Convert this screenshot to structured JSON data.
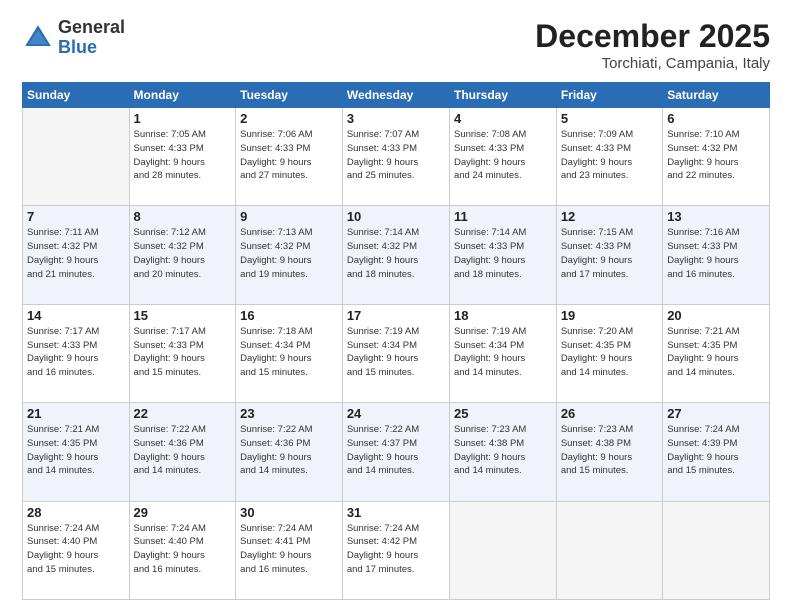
{
  "logo": {
    "general": "General",
    "blue": "Blue"
  },
  "header": {
    "month": "December 2025",
    "location": "Torchiati, Campania, Italy"
  },
  "days_of_week": [
    "Sunday",
    "Monday",
    "Tuesday",
    "Wednesday",
    "Thursday",
    "Friday",
    "Saturday"
  ],
  "weeks": [
    [
      {
        "num": "",
        "info": ""
      },
      {
        "num": "1",
        "info": "Sunrise: 7:05 AM\nSunset: 4:33 PM\nDaylight: 9 hours\nand 28 minutes."
      },
      {
        "num": "2",
        "info": "Sunrise: 7:06 AM\nSunset: 4:33 PM\nDaylight: 9 hours\nand 27 minutes."
      },
      {
        "num": "3",
        "info": "Sunrise: 7:07 AM\nSunset: 4:33 PM\nDaylight: 9 hours\nand 25 minutes."
      },
      {
        "num": "4",
        "info": "Sunrise: 7:08 AM\nSunset: 4:33 PM\nDaylight: 9 hours\nand 24 minutes."
      },
      {
        "num": "5",
        "info": "Sunrise: 7:09 AM\nSunset: 4:33 PM\nDaylight: 9 hours\nand 23 minutes."
      },
      {
        "num": "6",
        "info": "Sunrise: 7:10 AM\nSunset: 4:32 PM\nDaylight: 9 hours\nand 22 minutes."
      }
    ],
    [
      {
        "num": "7",
        "info": "Sunrise: 7:11 AM\nSunset: 4:32 PM\nDaylight: 9 hours\nand 21 minutes."
      },
      {
        "num": "8",
        "info": "Sunrise: 7:12 AM\nSunset: 4:32 PM\nDaylight: 9 hours\nand 20 minutes."
      },
      {
        "num": "9",
        "info": "Sunrise: 7:13 AM\nSunset: 4:32 PM\nDaylight: 9 hours\nand 19 minutes."
      },
      {
        "num": "10",
        "info": "Sunrise: 7:14 AM\nSunset: 4:32 PM\nDaylight: 9 hours\nand 18 minutes."
      },
      {
        "num": "11",
        "info": "Sunrise: 7:14 AM\nSunset: 4:33 PM\nDaylight: 9 hours\nand 18 minutes."
      },
      {
        "num": "12",
        "info": "Sunrise: 7:15 AM\nSunset: 4:33 PM\nDaylight: 9 hours\nand 17 minutes."
      },
      {
        "num": "13",
        "info": "Sunrise: 7:16 AM\nSunset: 4:33 PM\nDaylight: 9 hours\nand 16 minutes."
      }
    ],
    [
      {
        "num": "14",
        "info": "Sunrise: 7:17 AM\nSunset: 4:33 PM\nDaylight: 9 hours\nand 16 minutes."
      },
      {
        "num": "15",
        "info": "Sunrise: 7:17 AM\nSunset: 4:33 PM\nDaylight: 9 hours\nand 15 minutes."
      },
      {
        "num": "16",
        "info": "Sunrise: 7:18 AM\nSunset: 4:34 PM\nDaylight: 9 hours\nand 15 minutes."
      },
      {
        "num": "17",
        "info": "Sunrise: 7:19 AM\nSunset: 4:34 PM\nDaylight: 9 hours\nand 15 minutes."
      },
      {
        "num": "18",
        "info": "Sunrise: 7:19 AM\nSunset: 4:34 PM\nDaylight: 9 hours\nand 14 minutes."
      },
      {
        "num": "19",
        "info": "Sunrise: 7:20 AM\nSunset: 4:35 PM\nDaylight: 9 hours\nand 14 minutes."
      },
      {
        "num": "20",
        "info": "Sunrise: 7:21 AM\nSunset: 4:35 PM\nDaylight: 9 hours\nand 14 minutes."
      }
    ],
    [
      {
        "num": "21",
        "info": "Sunrise: 7:21 AM\nSunset: 4:35 PM\nDaylight: 9 hours\nand 14 minutes."
      },
      {
        "num": "22",
        "info": "Sunrise: 7:22 AM\nSunset: 4:36 PM\nDaylight: 9 hours\nand 14 minutes."
      },
      {
        "num": "23",
        "info": "Sunrise: 7:22 AM\nSunset: 4:36 PM\nDaylight: 9 hours\nand 14 minutes."
      },
      {
        "num": "24",
        "info": "Sunrise: 7:22 AM\nSunset: 4:37 PM\nDaylight: 9 hours\nand 14 minutes."
      },
      {
        "num": "25",
        "info": "Sunrise: 7:23 AM\nSunset: 4:38 PM\nDaylight: 9 hours\nand 14 minutes."
      },
      {
        "num": "26",
        "info": "Sunrise: 7:23 AM\nSunset: 4:38 PM\nDaylight: 9 hours\nand 15 minutes."
      },
      {
        "num": "27",
        "info": "Sunrise: 7:24 AM\nSunset: 4:39 PM\nDaylight: 9 hours\nand 15 minutes."
      }
    ],
    [
      {
        "num": "28",
        "info": "Sunrise: 7:24 AM\nSunset: 4:40 PM\nDaylight: 9 hours\nand 15 minutes."
      },
      {
        "num": "29",
        "info": "Sunrise: 7:24 AM\nSunset: 4:40 PM\nDaylight: 9 hours\nand 16 minutes."
      },
      {
        "num": "30",
        "info": "Sunrise: 7:24 AM\nSunset: 4:41 PM\nDaylight: 9 hours\nand 16 minutes."
      },
      {
        "num": "31",
        "info": "Sunrise: 7:24 AM\nSunset: 4:42 PM\nDaylight: 9 hours\nand 17 minutes."
      },
      {
        "num": "",
        "info": ""
      },
      {
        "num": "",
        "info": ""
      },
      {
        "num": "",
        "info": ""
      }
    ]
  ]
}
